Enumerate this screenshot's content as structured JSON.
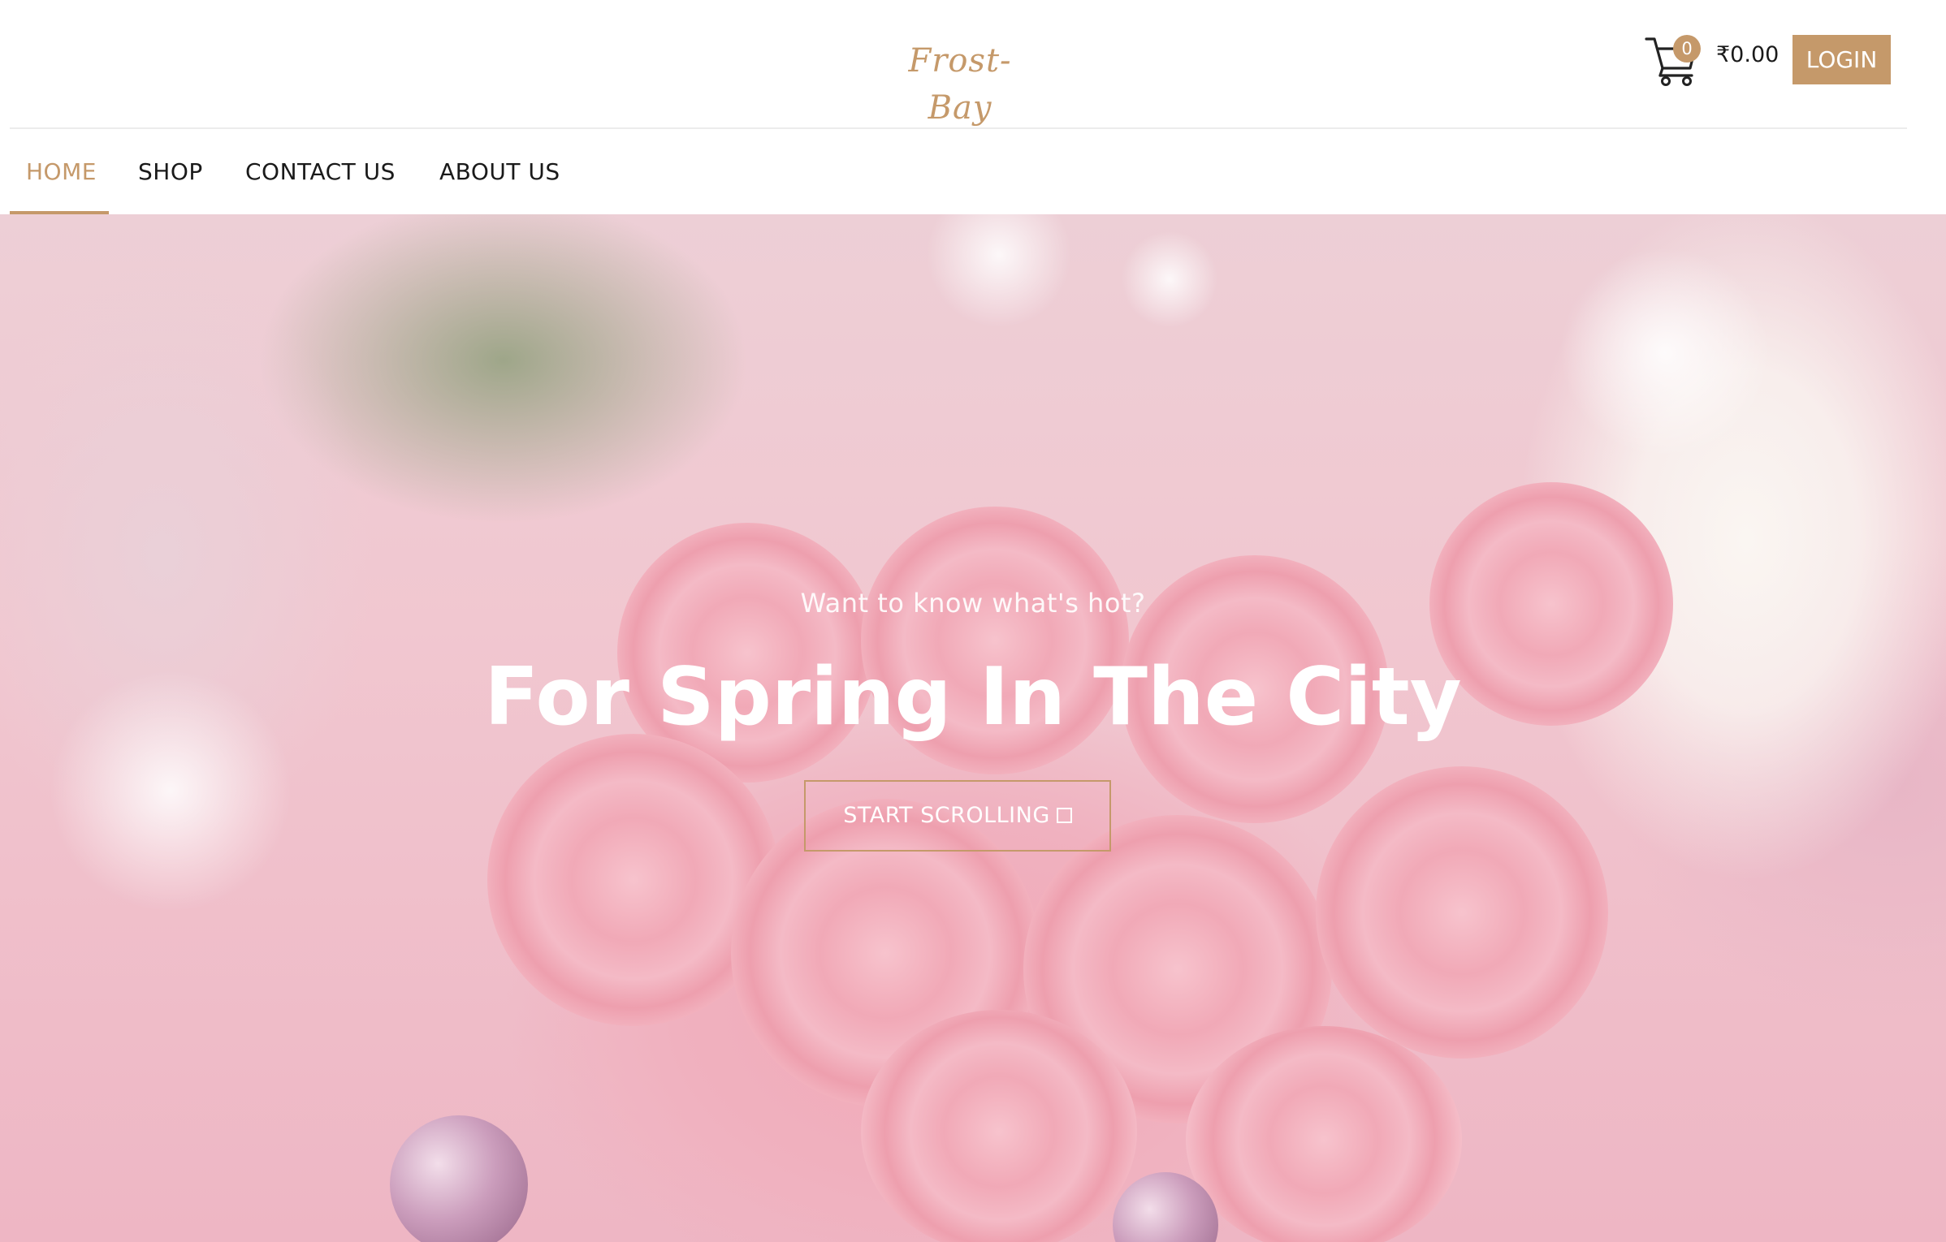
{
  "brand": {
    "logo_text": "Frost-Bay",
    "accent_color": "#c5996a"
  },
  "header": {
    "cart_icon": "cart-icon",
    "cart_count": "0",
    "cart_total": "₹0.00",
    "login_label": "LOGIN"
  },
  "nav": {
    "items": [
      {
        "label": "HOME",
        "active": true
      },
      {
        "label": "SHOP",
        "active": false
      },
      {
        "label": "CONTACT US",
        "active": false
      },
      {
        "label": "ABOUT US",
        "active": false
      }
    ]
  },
  "hero": {
    "subtitle": "Want to know what's hot?",
    "title": "For Spring In The City",
    "button_label": "START SCROLLING",
    "button_icon": "square-icon"
  }
}
